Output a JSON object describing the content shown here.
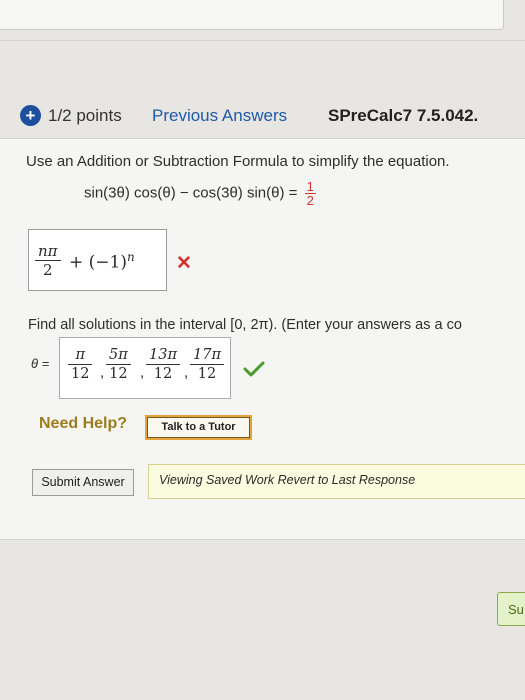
{
  "question": {
    "points": "1/2 points",
    "previous_answers": "Previous Answers",
    "id": "SPreCalc7 7.5.042.",
    "instruction": "Use an Addition or Subtraction Formula to simplify the equation.",
    "equation_lhs": "sin(3θ) cos(θ) − cos(3θ) sin(θ) =",
    "equation_rhs_num": "1",
    "equation_rhs_den": "2"
  },
  "answer1": {
    "frac_num": "nπ",
    "frac_den": "2",
    "rest_base": "+ (−1)",
    "rest_exp": "n",
    "status_mark": "✕",
    "status": "incorrect"
  },
  "part2": {
    "prompt": "Find all solutions in the interval [0, 2π). (Enter your answers as a co",
    "theta_label": "θ =",
    "solutions": [
      {
        "num": "π",
        "den": "12"
      },
      {
        "num": "5π",
        "den": "12"
      },
      {
        "num": "13π",
        "den": "12"
      },
      {
        "num": "17π",
        "den": "12"
      }
    ],
    "status": "correct"
  },
  "help": {
    "need_help": "Need Help?",
    "tutor_button": "Talk to a Tutor"
  },
  "footer": {
    "submit_button": "Submit Answer",
    "saved_text": "Viewing Saved Work Revert to Last Response",
    "side_button_text": "Su"
  },
  "colors": {
    "accent_blue": "#1e4f9c",
    "link_blue": "#1f5aa8",
    "error_red": "#d4302b",
    "correct_green": "#4a9a2d",
    "help_gold": "#9c7d1d"
  },
  "icons": {
    "points_icon": "plus-circle-icon",
    "incorrect_icon": "red-x-icon",
    "correct_icon": "green-check-icon"
  }
}
